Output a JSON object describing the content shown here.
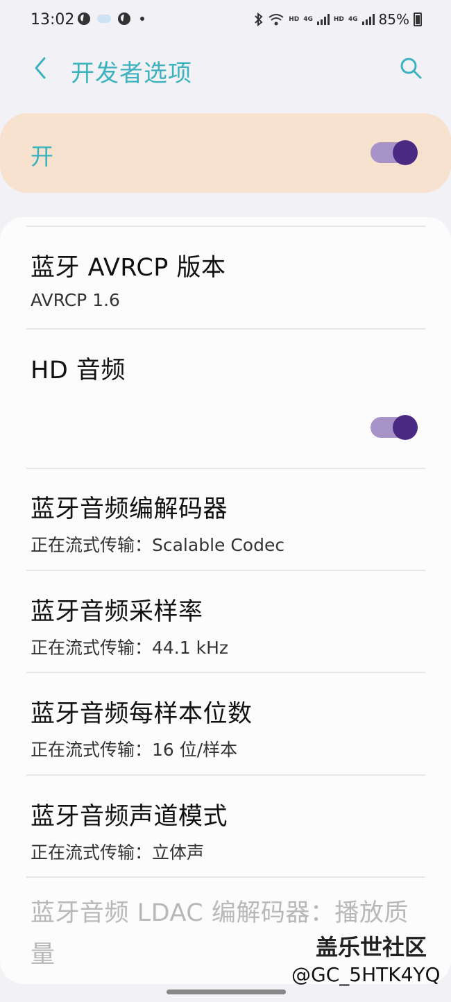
{
  "status_bar": {
    "time": "13:02",
    "battery": "85%",
    "hd_label_1": "HD",
    "hd_label_2": "HD",
    "net_label_1": "4G",
    "net_label_2": "4G"
  },
  "header": {
    "title": "开发者选项"
  },
  "master_switch": {
    "label": "开",
    "on": true
  },
  "items": [
    {
      "title": "蓝牙 AVRCP 版本",
      "subtitle": "AVRCP 1.6"
    },
    {
      "title": "HD 音频",
      "toggle_on": true
    },
    {
      "title": "蓝牙音频编解码器",
      "subtitle": "正在流式传输：Scalable Codec"
    },
    {
      "title": "蓝牙音频采样率",
      "subtitle": "正在流式传输：44.1 kHz"
    },
    {
      "title": "蓝牙音频每样本位数",
      "subtitle": "正在流式传输：16 位/样本"
    },
    {
      "title": "蓝牙音频声道模式",
      "subtitle": "正在流式传输：立体声"
    },
    {
      "title": "蓝牙音频 LDAC 编解码器：播放质量",
      "disabled": true
    }
  ],
  "watermark": {
    "line1": "盖乐世社区",
    "line2": "@GC_5HTK4YQ"
  },
  "colors": {
    "accent": "#3bb2bd",
    "toggle_thumb": "#4a2a82",
    "toggle_track": "#a893c8",
    "master_bg": "#f7e2d0"
  }
}
